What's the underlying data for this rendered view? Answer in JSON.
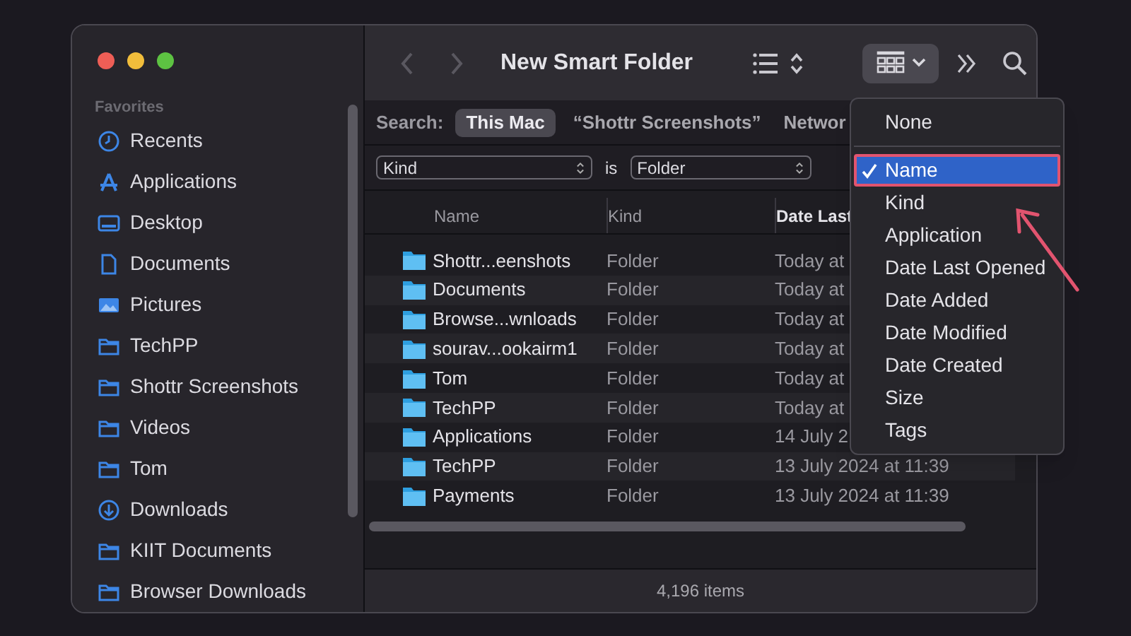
{
  "window": {
    "title": "New Smart Folder"
  },
  "sidebar": {
    "heading": "Favorites",
    "items": [
      {
        "label": "Recents"
      },
      {
        "label": "Applications"
      },
      {
        "label": "Desktop"
      },
      {
        "label": "Documents"
      },
      {
        "label": "Pictures"
      },
      {
        "label": "TechPP"
      },
      {
        "label": "Shottr Screenshots"
      },
      {
        "label": "Videos"
      },
      {
        "label": "Tom"
      },
      {
        "label": "Downloads"
      },
      {
        "label": "KIIT Documents"
      },
      {
        "label": "Browser Downloads"
      }
    ]
  },
  "search_bar": {
    "label": "Search:",
    "scopes": [
      {
        "label": "This Mac",
        "selected": true
      },
      {
        "label": "“Shottr Screenshots”",
        "selected": false
      },
      {
        "label": "Networ",
        "selected": false
      }
    ]
  },
  "criteria": {
    "attribute": "Kind",
    "operator": "is",
    "value": "Folder"
  },
  "table": {
    "columns": [
      {
        "label": "Name",
        "sorted": false
      },
      {
        "label": "Kind",
        "sorted": false
      },
      {
        "label": "Date Last",
        "sorted": true
      }
    ],
    "rows": [
      {
        "name": "Shottr...eenshots",
        "kind": "Folder",
        "date": "Today at"
      },
      {
        "name": "Documents",
        "kind": "Folder",
        "date": "Today at"
      },
      {
        "name": "Browse...wnloads",
        "kind": "Folder",
        "date": "Today at"
      },
      {
        "name": "sourav...ookairm1",
        "kind": "Folder",
        "date": "Today at"
      },
      {
        "name": "Tom",
        "kind": "Folder",
        "date": "Today at"
      },
      {
        "name": "TechPP",
        "kind": "Folder",
        "date": "Today at"
      },
      {
        "name": "Applications",
        "kind": "Folder",
        "date": "14 July 2"
      },
      {
        "name": "TechPP",
        "kind": "Folder",
        "date": "13 July 2024 at 11:39"
      },
      {
        "name": "Payments",
        "kind": "Folder",
        "date": "13 July 2024 at 11:39"
      }
    ]
  },
  "status_bar": {
    "text": "4,196 items"
  },
  "group_menu": {
    "items": [
      {
        "label": "None",
        "selected": false,
        "separator_after": true
      },
      {
        "label": "Name",
        "selected": true,
        "separator_after": false
      },
      {
        "label": "Kind",
        "selected": false,
        "separator_after": false
      },
      {
        "label": "Application",
        "selected": false,
        "separator_after": false
      },
      {
        "label": "Date Last Opened",
        "selected": false,
        "separator_after": false
      },
      {
        "label": "Date Added",
        "selected": false,
        "separator_after": false
      },
      {
        "label": "Date Modified",
        "selected": false,
        "separator_after": false
      },
      {
        "label": "Date Created",
        "selected": false,
        "separator_after": false
      },
      {
        "label": "Size",
        "selected": false,
        "separator_after": false
      },
      {
        "label": "Tags",
        "selected": false,
        "separator_after": false
      }
    ]
  }
}
